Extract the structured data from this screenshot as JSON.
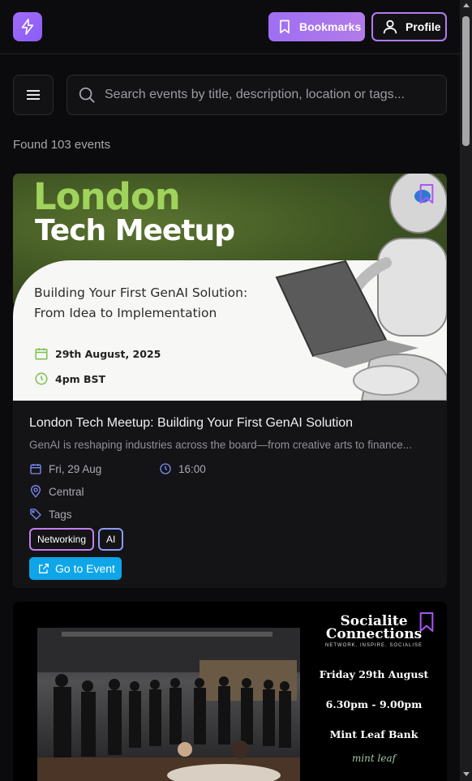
{
  "header": {
    "logo_icon": "sparkle-bolt-icon",
    "bookmarks_label": "Bookmarks",
    "profile_label": "Profile",
    "accent": "#a06cf7"
  },
  "search": {
    "placeholder": "Search events by title, description, location or tags...",
    "value": ""
  },
  "results": {
    "found_text": "Found 103 events"
  },
  "events": [
    {
      "poster": {
        "title_line1": "London",
        "title_line2": "Tech Meetup",
        "subtitle_line1": "Building Your First GenAI Solution:",
        "subtitle_line2": "From Idea to Implementation",
        "date": "29th August, 2025",
        "time": "4pm BST"
      },
      "title": "London Tech Meetup: Building Your First GenAI Solution",
      "description": "GenAI is reshaping industries across the board—from creative arts to finance...",
      "date": "Fri, 29 Aug",
      "time": "16:00",
      "location": "Central",
      "tags_label": "Tags",
      "tags": [
        "Networking",
        "AI"
      ],
      "cta_label": "Go to Event"
    },
    {
      "poster": {
        "brand_line1": "Socialite",
        "brand_line2": "Connections",
        "brand_tagline": "NETWORK. INSPIRE. SOCIALISE",
        "date": "Friday 29th August",
        "time": "6.30pm - 9.00pm",
        "venue": "Mint Leaf Bank",
        "venue_script": "mint leaf"
      }
    }
  ]
}
